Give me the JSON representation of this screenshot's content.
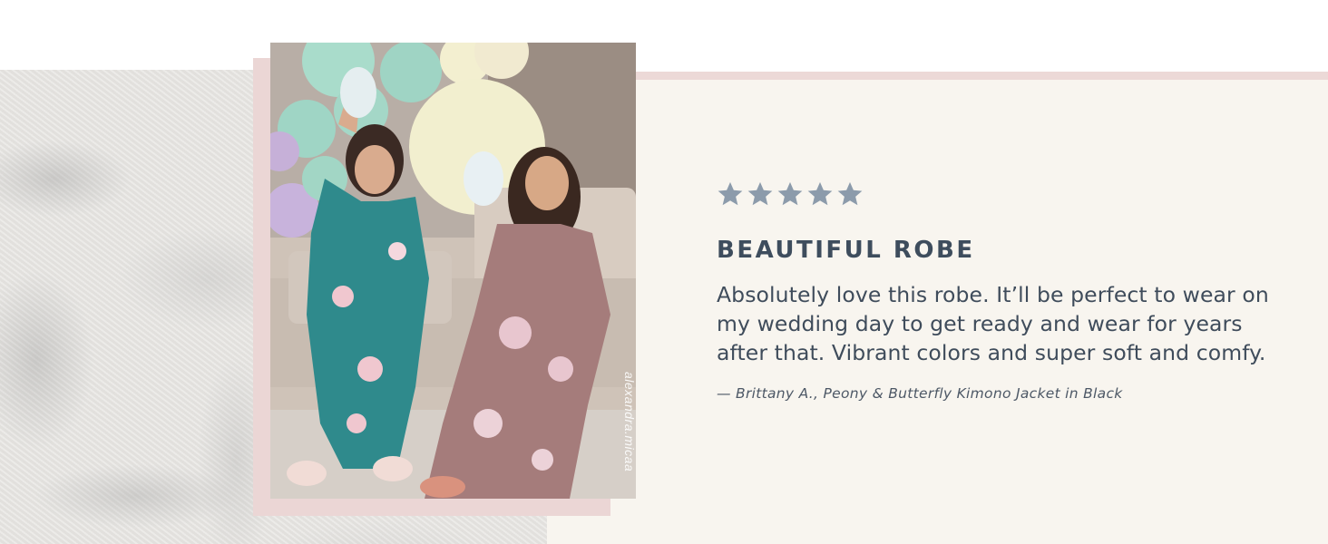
{
  "review": {
    "rating": 5,
    "max_rating": 5,
    "star_color": "#8c9bab",
    "title": "BEAUTIFUL ROBE",
    "body": "Absolutely love this robe. It’ll be perfect to wear on my wedding day to get ready and wear for years after that. Vibrant colors and super soft and comfy.",
    "attribution": "— Brittany A., Peony & Butterfly Kimono Jacket in Black"
  },
  "photo": {
    "watermark": "alexandra.micaa"
  },
  "colors": {
    "panel_background": "#f8f5ef",
    "accent_pink": "#ecd9d7",
    "text": "#3e4d5d"
  }
}
